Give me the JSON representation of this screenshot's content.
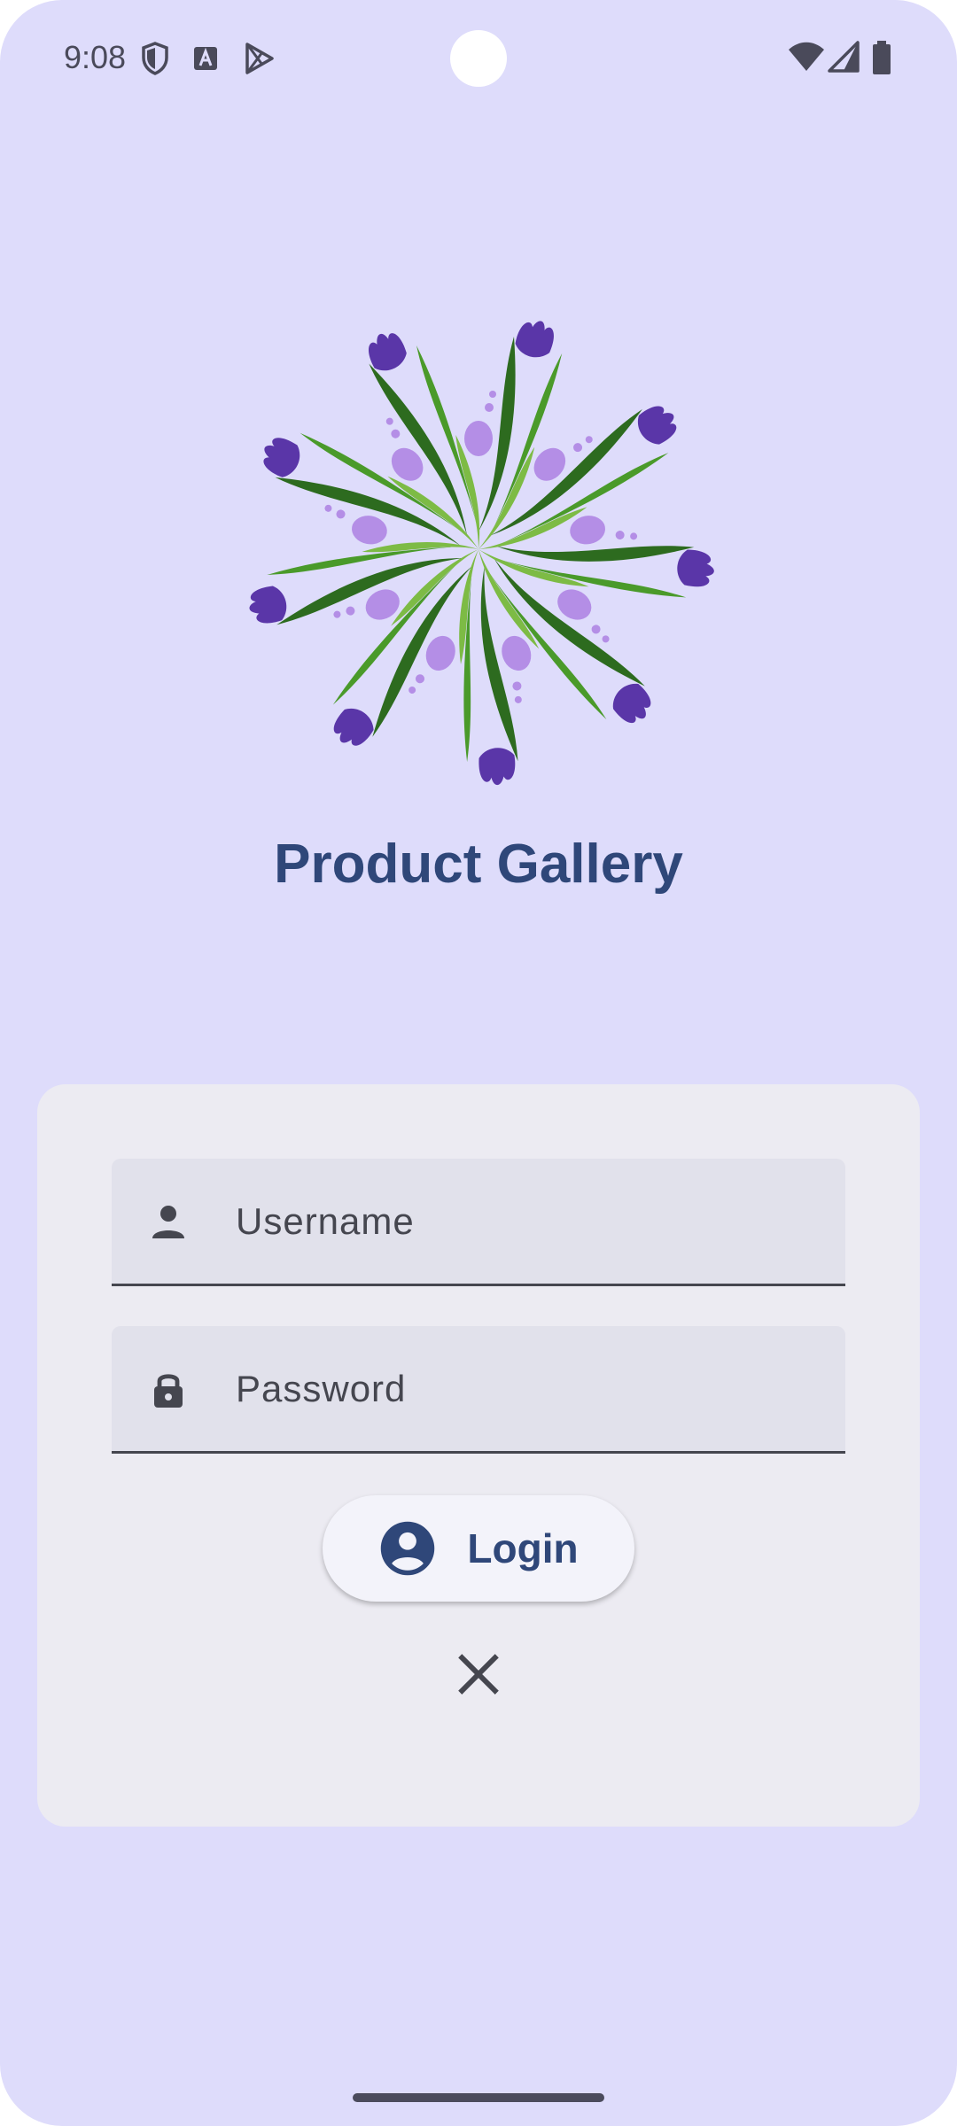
{
  "status_bar": {
    "time": "9:08",
    "left_icons": [
      "shield-icon",
      "a-badge-icon",
      "play-store-icon"
    ],
    "right_icons": [
      "wifi-icon",
      "signal-icon",
      "battery-icon"
    ]
  },
  "app": {
    "title": "Product Gallery",
    "logo": "floral-wreath-logo"
  },
  "login_form": {
    "username": {
      "placeholder": "Username",
      "value": "",
      "icon": "person-icon"
    },
    "password": {
      "placeholder": "Password",
      "value": "",
      "icon": "lock-icon"
    },
    "login_button": {
      "label": "Login",
      "icon": "account-circle-icon"
    },
    "close_button": {
      "icon": "close-icon"
    }
  },
  "colors": {
    "background": "#dedcfb",
    "card": "#ecebf2",
    "field": "#e1e1eb",
    "accent": "#2f4779"
  }
}
